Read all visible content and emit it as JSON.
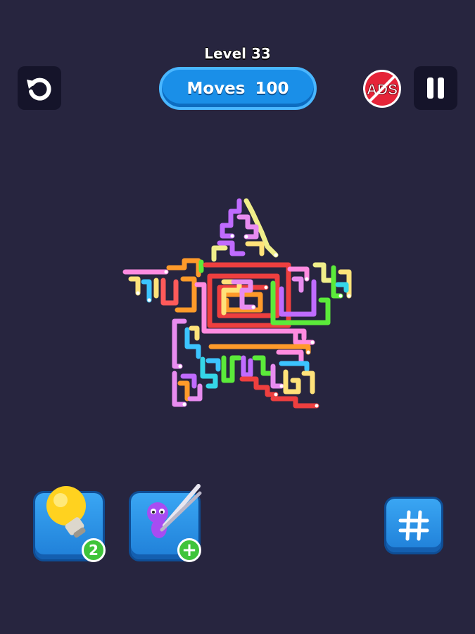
{
  "header": {
    "level_label": "Level 33",
    "moves_label": "Moves",
    "moves_value": "100",
    "no_ads_label": "ADS"
  },
  "icons": {
    "restart": "restart-icon",
    "pause": "pause-icon",
    "hint": "lightbulb-icon",
    "grab": "tweezers-worm-icon",
    "grid": "hashtag-grid-icon"
  },
  "boosters": {
    "hint_count": "2",
    "grab_add": "+"
  },
  "colors": {
    "background": "#27253f",
    "button_blue": "#1f8ae6",
    "badge_green": "#3fc43a",
    "no_ads_red": "#e52438",
    "arrows": [
      "#ff8be0",
      "#ffe27a",
      "#ff5a5a",
      "#c06bff",
      "#3cc4ff",
      "#5bea3a",
      "#ff9a2a",
      "#ee3f3f",
      "#e88cf0",
      "#f0ee8a",
      "#35d6e8",
      "#a94bf5"
    ]
  },
  "puzzle": {
    "shape": "star",
    "arrow_palette": [
      "pink",
      "yellow",
      "red",
      "purple",
      "blue",
      "green",
      "orange",
      "cyan"
    ]
  }
}
